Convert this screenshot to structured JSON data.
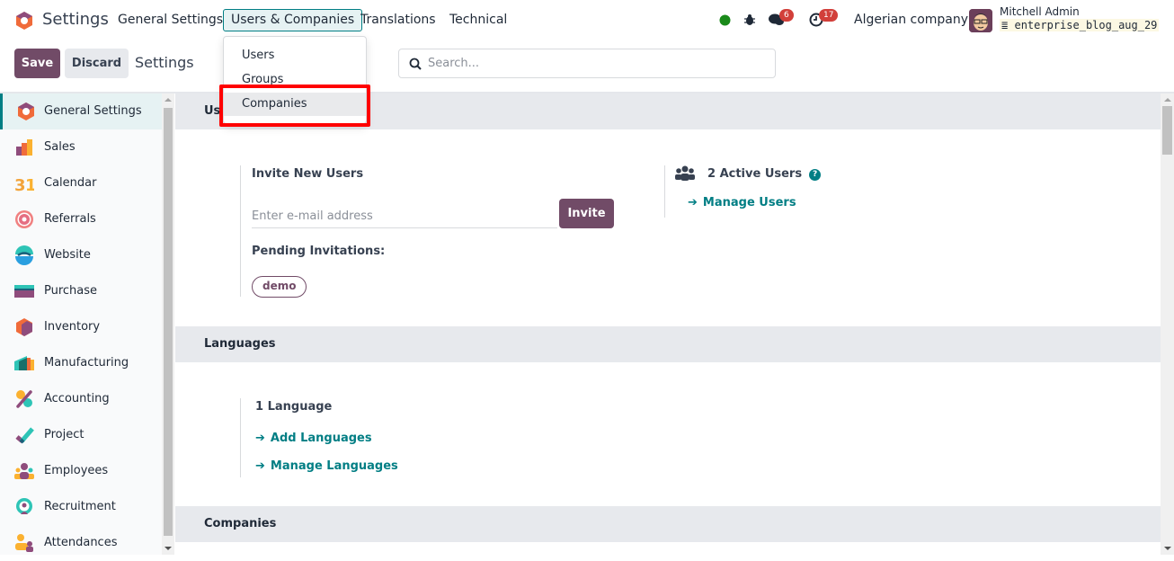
{
  "topbar": {
    "app_name": "Settings",
    "menu": [
      {
        "label": "General Settings",
        "active": false
      },
      {
        "label": "Users & Companies",
        "active": true
      },
      {
        "label": "Translations",
        "active": false
      },
      {
        "label": "Technical",
        "active": false
      }
    ],
    "status_color": "#1a8a1a",
    "messages_count": "6",
    "activities_count": "17",
    "company": "Algerian company",
    "user_name": "Mitchell Admin",
    "database": "enterprise_blog_aug_29"
  },
  "control_panel": {
    "save_label": "Save",
    "discard_label": "Discard",
    "title": "Settings",
    "search_placeholder": "Search..."
  },
  "dropdown": {
    "items": [
      {
        "label": "Users"
      },
      {
        "label": "Groups"
      },
      {
        "label": "Companies",
        "hovered": true,
        "highlighted": true
      }
    ]
  },
  "sidebar": {
    "items": [
      {
        "label": "General Settings",
        "icon": "settings-icon",
        "active": true
      },
      {
        "label": "Sales",
        "icon": "sales-icon"
      },
      {
        "label": "Calendar",
        "icon": "calendar-icon"
      },
      {
        "label": "Referrals",
        "icon": "referrals-icon"
      },
      {
        "label": "Website",
        "icon": "website-icon"
      },
      {
        "label": "Purchase",
        "icon": "purchase-icon"
      },
      {
        "label": "Inventory",
        "icon": "inventory-icon"
      },
      {
        "label": "Manufacturing",
        "icon": "manufacturing-icon"
      },
      {
        "label": "Accounting",
        "icon": "accounting-icon"
      },
      {
        "label": "Project",
        "icon": "project-icon"
      },
      {
        "label": "Employees",
        "icon": "employees-icon"
      },
      {
        "label": "Recruitment",
        "icon": "recruitment-icon"
      },
      {
        "label": "Attendances",
        "icon": "attendances-icon"
      }
    ]
  },
  "sections": {
    "users": {
      "title": "Users",
      "invite_label": "Invite New Users",
      "email_placeholder": "Enter e-mail address",
      "invite_button": "Invite",
      "pending_label": "Pending Invitations:",
      "pending": [
        "demo"
      ],
      "active_users": "2 Active Users",
      "manage_users": "Manage Users"
    },
    "languages": {
      "title": "Languages",
      "count": "1 Language",
      "add": "Add Languages",
      "manage": "Manage Languages"
    },
    "companies": {
      "title": "Companies"
    }
  }
}
